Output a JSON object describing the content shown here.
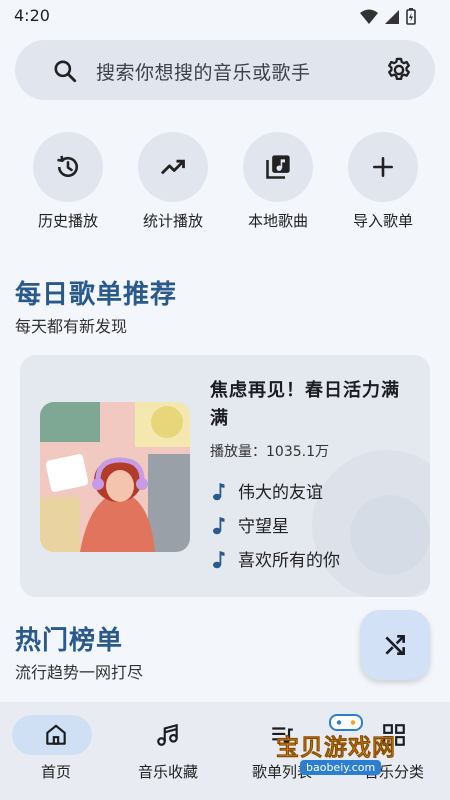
{
  "status_bar": {
    "time": "4:20"
  },
  "search": {
    "placeholder": "搜索你想搜的音乐或歌手"
  },
  "quick_actions": [
    {
      "label": "历史播放",
      "icon": "history-icon"
    },
    {
      "label": "统计播放",
      "icon": "trending-up-icon"
    },
    {
      "label": "本地歌曲",
      "icon": "library-music-icon"
    },
    {
      "label": "导入歌单",
      "icon": "add-icon"
    }
  ],
  "daily": {
    "title": "每日歌单推荐",
    "subtitle": "每天都有新发现",
    "playlist": {
      "title": "焦虑再见！春日活力满满",
      "play_count": "播放量：1035.1万",
      "songs": [
        "伟大的友谊",
        "守望星",
        "喜欢所有的你"
      ]
    }
  },
  "hot": {
    "title": "热门榜单",
    "subtitle": "流行趋势一网打尽"
  },
  "bottom_nav": [
    {
      "label": "首页",
      "icon": "home-icon",
      "selected": true
    },
    {
      "label": "音乐收藏",
      "icon": "music-notes-icon",
      "selected": false
    },
    {
      "label": "歌单列表",
      "icon": "queue-music-icon",
      "selected": false
    },
    {
      "label": "音乐分类",
      "icon": "category-icon",
      "selected": false
    }
  ],
  "watermark": {
    "text": "宝贝游戏网",
    "url": "baobeiy.com"
  },
  "colors": {
    "accent": "#2a5a8c",
    "background": "#f3f6fb",
    "surface": "#e1e6ee",
    "nav_selected": "#cfe0f4"
  }
}
